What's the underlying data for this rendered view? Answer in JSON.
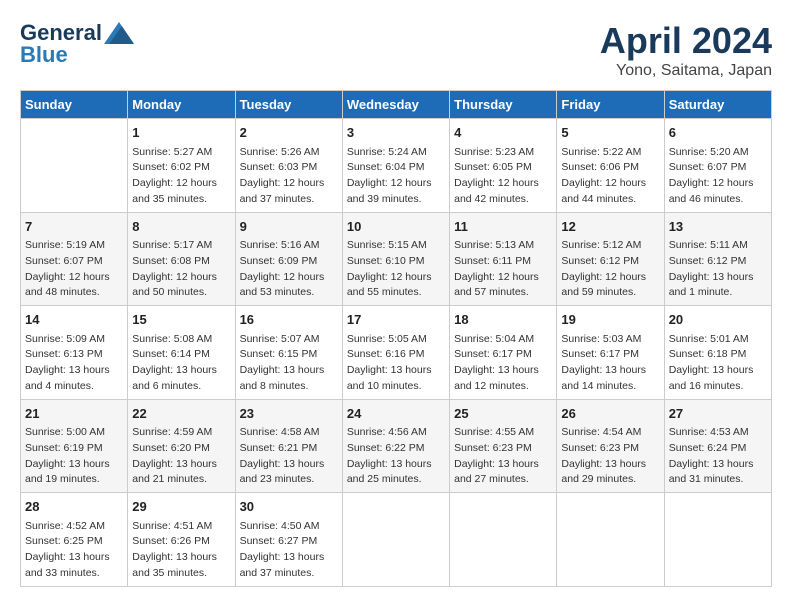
{
  "logo": {
    "general": "General",
    "blue": "Blue"
  },
  "title": "April 2024",
  "subtitle": "Yono, Saitama, Japan",
  "weekdays": [
    "Sunday",
    "Monday",
    "Tuesday",
    "Wednesday",
    "Thursday",
    "Friday",
    "Saturday"
  ],
  "weeks": [
    [
      {
        "day": null,
        "info": null
      },
      {
        "day": "1",
        "info": "Sunrise: 5:27 AM\nSunset: 6:02 PM\nDaylight: 12 hours\nand 35 minutes."
      },
      {
        "day": "2",
        "info": "Sunrise: 5:26 AM\nSunset: 6:03 PM\nDaylight: 12 hours\nand 37 minutes."
      },
      {
        "day": "3",
        "info": "Sunrise: 5:24 AM\nSunset: 6:04 PM\nDaylight: 12 hours\nand 39 minutes."
      },
      {
        "day": "4",
        "info": "Sunrise: 5:23 AM\nSunset: 6:05 PM\nDaylight: 12 hours\nand 42 minutes."
      },
      {
        "day": "5",
        "info": "Sunrise: 5:22 AM\nSunset: 6:06 PM\nDaylight: 12 hours\nand 44 minutes."
      },
      {
        "day": "6",
        "info": "Sunrise: 5:20 AM\nSunset: 6:07 PM\nDaylight: 12 hours\nand 46 minutes."
      }
    ],
    [
      {
        "day": "7",
        "info": "Sunrise: 5:19 AM\nSunset: 6:07 PM\nDaylight: 12 hours\nand 48 minutes."
      },
      {
        "day": "8",
        "info": "Sunrise: 5:17 AM\nSunset: 6:08 PM\nDaylight: 12 hours\nand 50 minutes."
      },
      {
        "day": "9",
        "info": "Sunrise: 5:16 AM\nSunset: 6:09 PM\nDaylight: 12 hours\nand 53 minutes."
      },
      {
        "day": "10",
        "info": "Sunrise: 5:15 AM\nSunset: 6:10 PM\nDaylight: 12 hours\nand 55 minutes."
      },
      {
        "day": "11",
        "info": "Sunrise: 5:13 AM\nSunset: 6:11 PM\nDaylight: 12 hours\nand 57 minutes."
      },
      {
        "day": "12",
        "info": "Sunrise: 5:12 AM\nSunset: 6:12 PM\nDaylight: 12 hours\nand 59 minutes."
      },
      {
        "day": "13",
        "info": "Sunrise: 5:11 AM\nSunset: 6:12 PM\nDaylight: 13 hours\nand 1 minute."
      }
    ],
    [
      {
        "day": "14",
        "info": "Sunrise: 5:09 AM\nSunset: 6:13 PM\nDaylight: 13 hours\nand 4 minutes."
      },
      {
        "day": "15",
        "info": "Sunrise: 5:08 AM\nSunset: 6:14 PM\nDaylight: 13 hours\nand 6 minutes."
      },
      {
        "day": "16",
        "info": "Sunrise: 5:07 AM\nSunset: 6:15 PM\nDaylight: 13 hours\nand 8 minutes."
      },
      {
        "day": "17",
        "info": "Sunrise: 5:05 AM\nSunset: 6:16 PM\nDaylight: 13 hours\nand 10 minutes."
      },
      {
        "day": "18",
        "info": "Sunrise: 5:04 AM\nSunset: 6:17 PM\nDaylight: 13 hours\nand 12 minutes."
      },
      {
        "day": "19",
        "info": "Sunrise: 5:03 AM\nSunset: 6:17 PM\nDaylight: 13 hours\nand 14 minutes."
      },
      {
        "day": "20",
        "info": "Sunrise: 5:01 AM\nSunset: 6:18 PM\nDaylight: 13 hours\nand 16 minutes."
      }
    ],
    [
      {
        "day": "21",
        "info": "Sunrise: 5:00 AM\nSunset: 6:19 PM\nDaylight: 13 hours\nand 19 minutes."
      },
      {
        "day": "22",
        "info": "Sunrise: 4:59 AM\nSunset: 6:20 PM\nDaylight: 13 hours\nand 21 minutes."
      },
      {
        "day": "23",
        "info": "Sunrise: 4:58 AM\nSunset: 6:21 PM\nDaylight: 13 hours\nand 23 minutes."
      },
      {
        "day": "24",
        "info": "Sunrise: 4:56 AM\nSunset: 6:22 PM\nDaylight: 13 hours\nand 25 minutes."
      },
      {
        "day": "25",
        "info": "Sunrise: 4:55 AM\nSunset: 6:23 PM\nDaylight: 13 hours\nand 27 minutes."
      },
      {
        "day": "26",
        "info": "Sunrise: 4:54 AM\nSunset: 6:23 PM\nDaylight: 13 hours\nand 29 minutes."
      },
      {
        "day": "27",
        "info": "Sunrise: 4:53 AM\nSunset: 6:24 PM\nDaylight: 13 hours\nand 31 minutes."
      }
    ],
    [
      {
        "day": "28",
        "info": "Sunrise: 4:52 AM\nSunset: 6:25 PM\nDaylight: 13 hours\nand 33 minutes."
      },
      {
        "day": "29",
        "info": "Sunrise: 4:51 AM\nSunset: 6:26 PM\nDaylight: 13 hours\nand 35 minutes."
      },
      {
        "day": "30",
        "info": "Sunrise: 4:50 AM\nSunset: 6:27 PM\nDaylight: 13 hours\nand 37 minutes."
      },
      {
        "day": null,
        "info": null
      },
      {
        "day": null,
        "info": null
      },
      {
        "day": null,
        "info": null
      },
      {
        "day": null,
        "info": null
      }
    ]
  ]
}
